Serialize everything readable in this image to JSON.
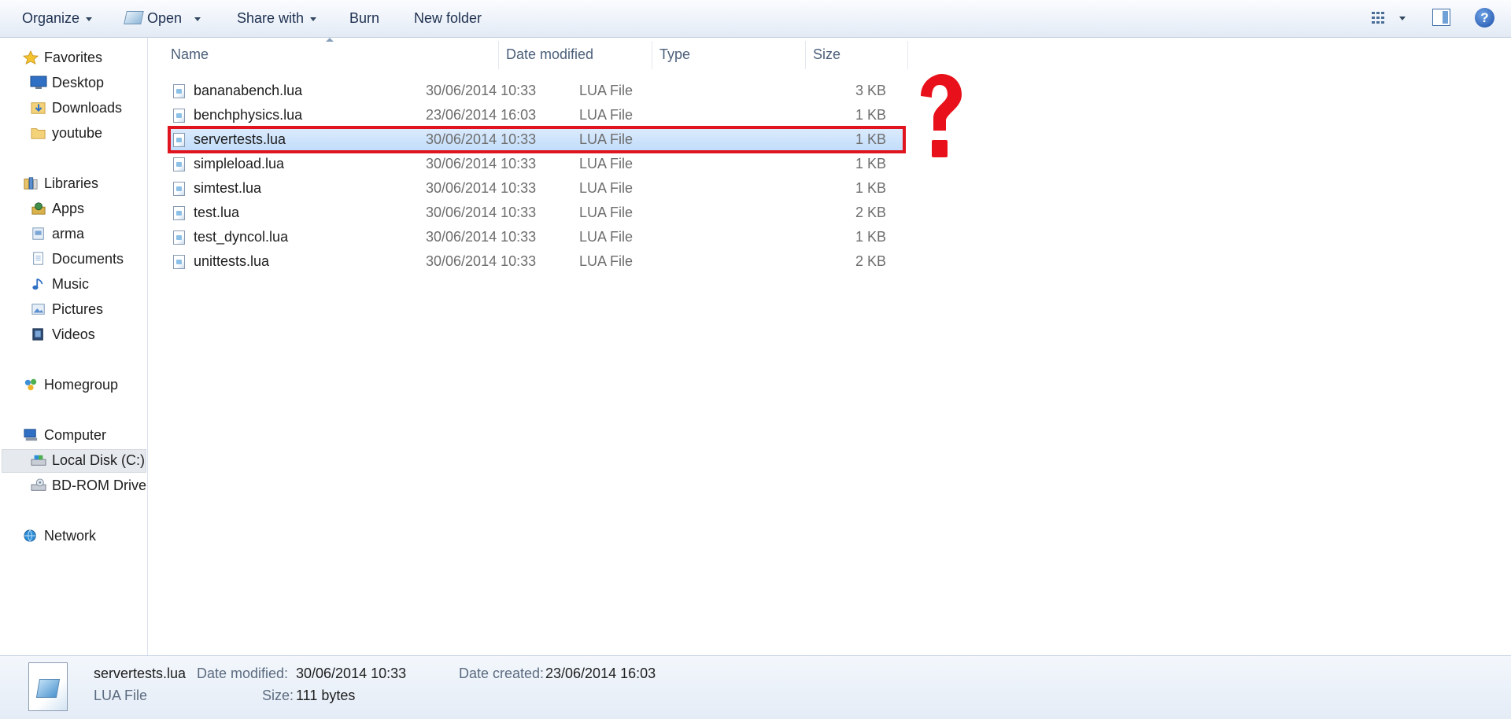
{
  "toolbar": {
    "organize": "Organize",
    "open": "Open",
    "share_with": "Share with",
    "burn": "Burn",
    "new_folder": "New folder",
    "icons": [
      "view-options-icon",
      "preview-pane-icon",
      "help-icon"
    ],
    "help_glyph": "?"
  },
  "nav": {
    "favorites": "Favorites",
    "desktop": "Desktop",
    "downloads": "Downloads",
    "youtube": "youtube",
    "libraries": "Libraries",
    "apps": "Apps",
    "arma": "arma",
    "documents": "Documents",
    "music": "Music",
    "pictures": "Pictures",
    "videos": "Videos",
    "homegroup": "Homegroup",
    "computer": "Computer",
    "local_disk": "Local Disk (C:)",
    "bd_rom": "BD-ROM Drive",
    "network": "Network",
    "selected": "Local Disk (C:)"
  },
  "columns": {
    "name": "Name",
    "date_modified": "Date modified",
    "type": "Type",
    "size": "Size"
  },
  "files": [
    {
      "name": "bananabench.lua",
      "date": "30/06/2014 10:33",
      "type": "LUA File",
      "size": "3 KB"
    },
    {
      "name": "benchphysics.lua",
      "date": "23/06/2014 16:03",
      "type": "LUA File",
      "size": "1 KB"
    },
    {
      "name": "servertests.lua",
      "date": "30/06/2014 10:33",
      "type": "LUA File",
      "size": "1 KB"
    },
    {
      "name": "simpleload.lua",
      "date": "30/06/2014 10:33",
      "type": "LUA File",
      "size": "1 KB"
    },
    {
      "name": "simtest.lua",
      "date": "30/06/2014 10:33",
      "type": "LUA File",
      "size": "1 KB"
    },
    {
      "name": "test.lua",
      "date": "30/06/2014 10:33",
      "type": "LUA File",
      "size": "2 KB"
    },
    {
      "name": "test_dyncol.lua",
      "date": "30/06/2014 10:33",
      "type": "LUA File",
      "size": "1 KB"
    },
    {
      "name": "unittests.lua",
      "date": "30/06/2014 10:33",
      "type": "LUA File",
      "size": "2 KB"
    }
  ],
  "selected_file": "servertests.lua",
  "annotation": {
    "box_color": "#e0141e",
    "mark_color": "#e8111b"
  },
  "details": {
    "filename": "servertests.lua",
    "filetype": "LUA File",
    "date_modified_label": "Date modified:",
    "date_modified": "30/06/2014 10:33",
    "size_label": "Size:",
    "size": "111 bytes",
    "date_created_label": "Date created:",
    "date_created": "23/06/2014 16:03"
  }
}
